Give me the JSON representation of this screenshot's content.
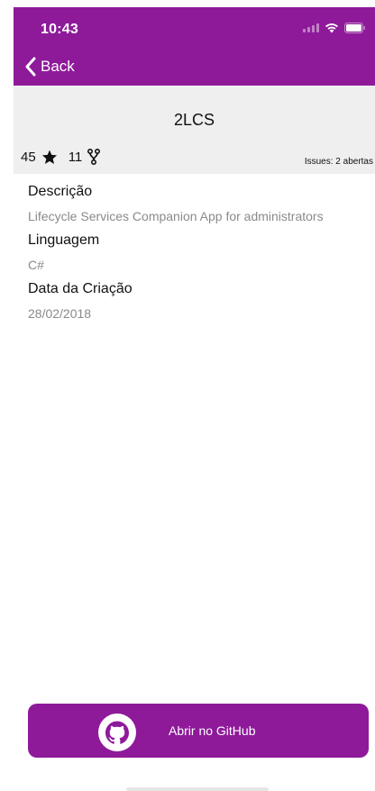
{
  "status_bar": {
    "time": "10:43",
    "icons": [
      "cellular-signal-icon",
      "wifi-icon",
      "battery-icon"
    ]
  },
  "nav": {
    "back_label": "Back"
  },
  "repo": {
    "name": "2LCS",
    "stars": "45",
    "forks": "11",
    "issues": "Issues: 2 abertas"
  },
  "details": {
    "description_label": "Descrição",
    "description_value": "Lifecycle Services Companion App for administrators",
    "language_label": "Linguagem",
    "language_value": "C#",
    "created_label": "Data da Criação",
    "created_value": "28/02/2018"
  },
  "actions": {
    "open_github_label": "Abrir no GitHub"
  },
  "colors": {
    "brand": "#8e1a9a",
    "title_bar_bg": "#efefef",
    "secondary_text": "#8a8a8a"
  }
}
